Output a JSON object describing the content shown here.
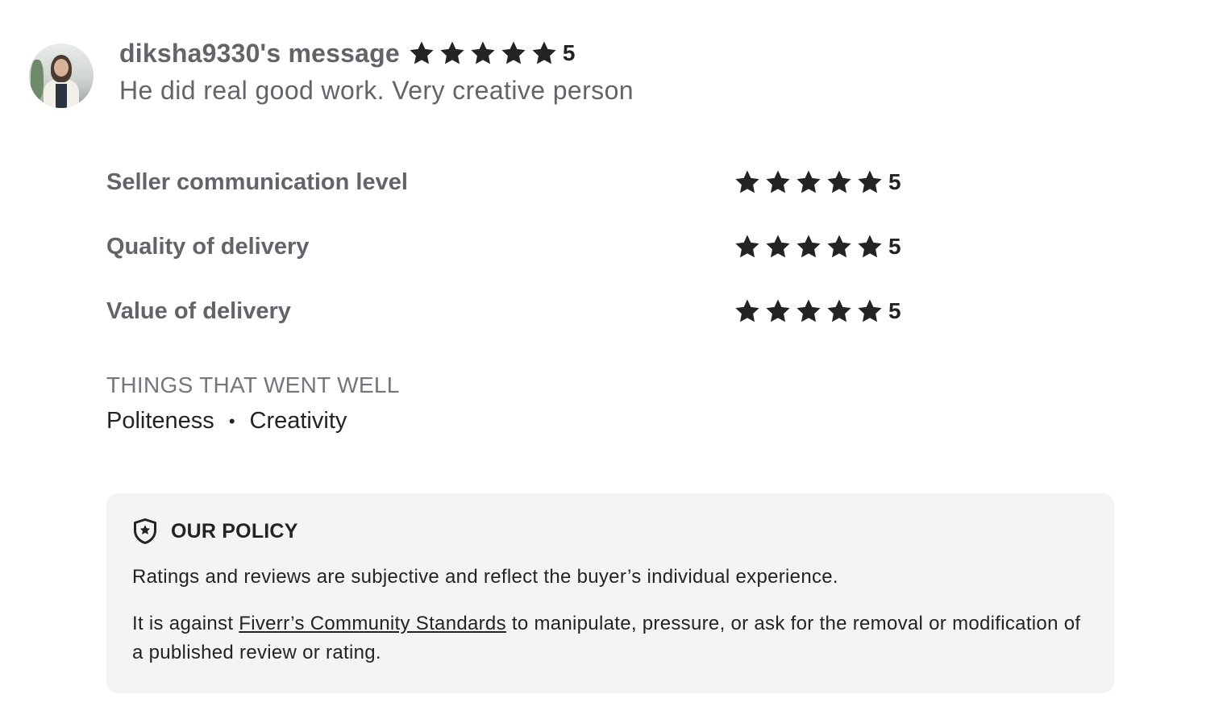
{
  "review": {
    "username_line": "diksha9330's message",
    "rating": "5",
    "text": "He did real good work. Very creative person"
  },
  "breakdown": [
    {
      "label": "Seller communication level",
      "rating": "5"
    },
    {
      "label": "Quality of delivery",
      "rating": "5"
    },
    {
      "label": "Value of delivery",
      "rating": "5"
    }
  ],
  "things_went_well": {
    "heading": "THINGS THAT WENT WELL",
    "items": [
      "Politeness",
      "Creativity"
    ],
    "separator": "•"
  },
  "policy": {
    "icon": "shield-star-icon",
    "title": "OUR POLICY",
    "paragraph1": "Ratings and reviews are subjective and reflect the buyer’s individual experience.",
    "paragraph2_prefix": "It is against ",
    "paragraph2_link": "Fiverr’s Community Standards",
    "paragraph2_suffix": " to manipulate, pressure, or ask for the removal or modification of a published review or rating."
  },
  "colors": {
    "star": "#222325",
    "policy_bg": "#f4f4f4",
    "muted_text": "#62646a"
  }
}
